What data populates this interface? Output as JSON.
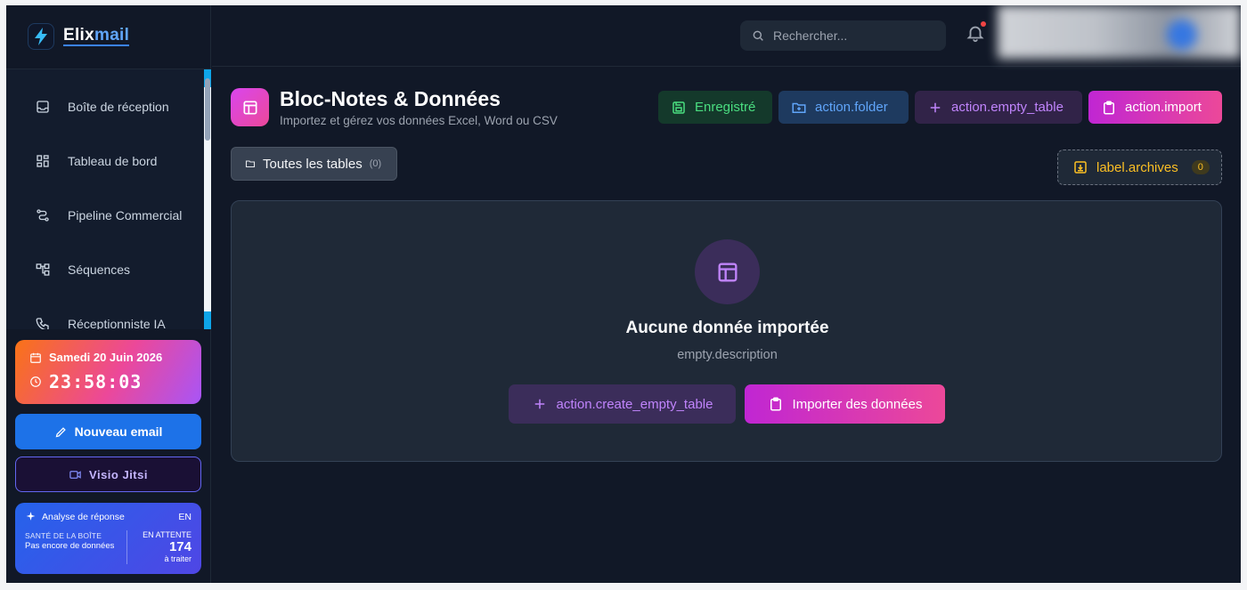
{
  "app": {
    "name_part1": "Elix",
    "name_part2": "mail"
  },
  "sidebar": {
    "items": [
      {
        "label": "Boîte de réception",
        "icon": "inbox-icon"
      },
      {
        "label": "Tableau de bord",
        "icon": "dashboard-icon"
      },
      {
        "label": "Pipeline Commercial",
        "icon": "pipeline-icon"
      },
      {
        "label": "Séquences",
        "icon": "sequences-icon"
      },
      {
        "label": "Réceptionniste IA",
        "icon": "phone-icon"
      }
    ],
    "date": "Samedi 20 Juin 2026",
    "time": "23:58:03",
    "new_email": "Nouveau email",
    "visio": "Visio Jitsi",
    "analyse": {
      "title": "Analyse de réponse",
      "lang": "EN",
      "health_label": "SANTÉ DE LA BOÎTE",
      "health_value": "Pas encore de données",
      "pending_label": "EN ATTENTE",
      "pending_count": "174",
      "pending_sub": "à traiter"
    }
  },
  "topbar": {
    "search_placeholder": "Rechercher..."
  },
  "page": {
    "title": "Bloc-Notes & Données",
    "subtitle": "Importez et gérez vos données Excel, Word ou CSV",
    "actions": {
      "saved": "Enregistré",
      "folder": "action.folder",
      "empty_table": "action.empty_table",
      "import": "action.import"
    },
    "tab_all": {
      "label": "Toutes les tables",
      "count": "(0)"
    },
    "archives": {
      "label": "label.archives",
      "count": "0"
    },
    "empty": {
      "title": "Aucune donnée importée",
      "description": "empty.description",
      "create_btn": "action.create_empty_table",
      "import_btn": "Importer des données"
    }
  },
  "colors": {
    "accent_pink": "#ec4899",
    "accent_purple": "#c084fc",
    "accent_blue": "#1d72e8",
    "success": "#4ade80",
    "warning": "#fbbf24"
  }
}
